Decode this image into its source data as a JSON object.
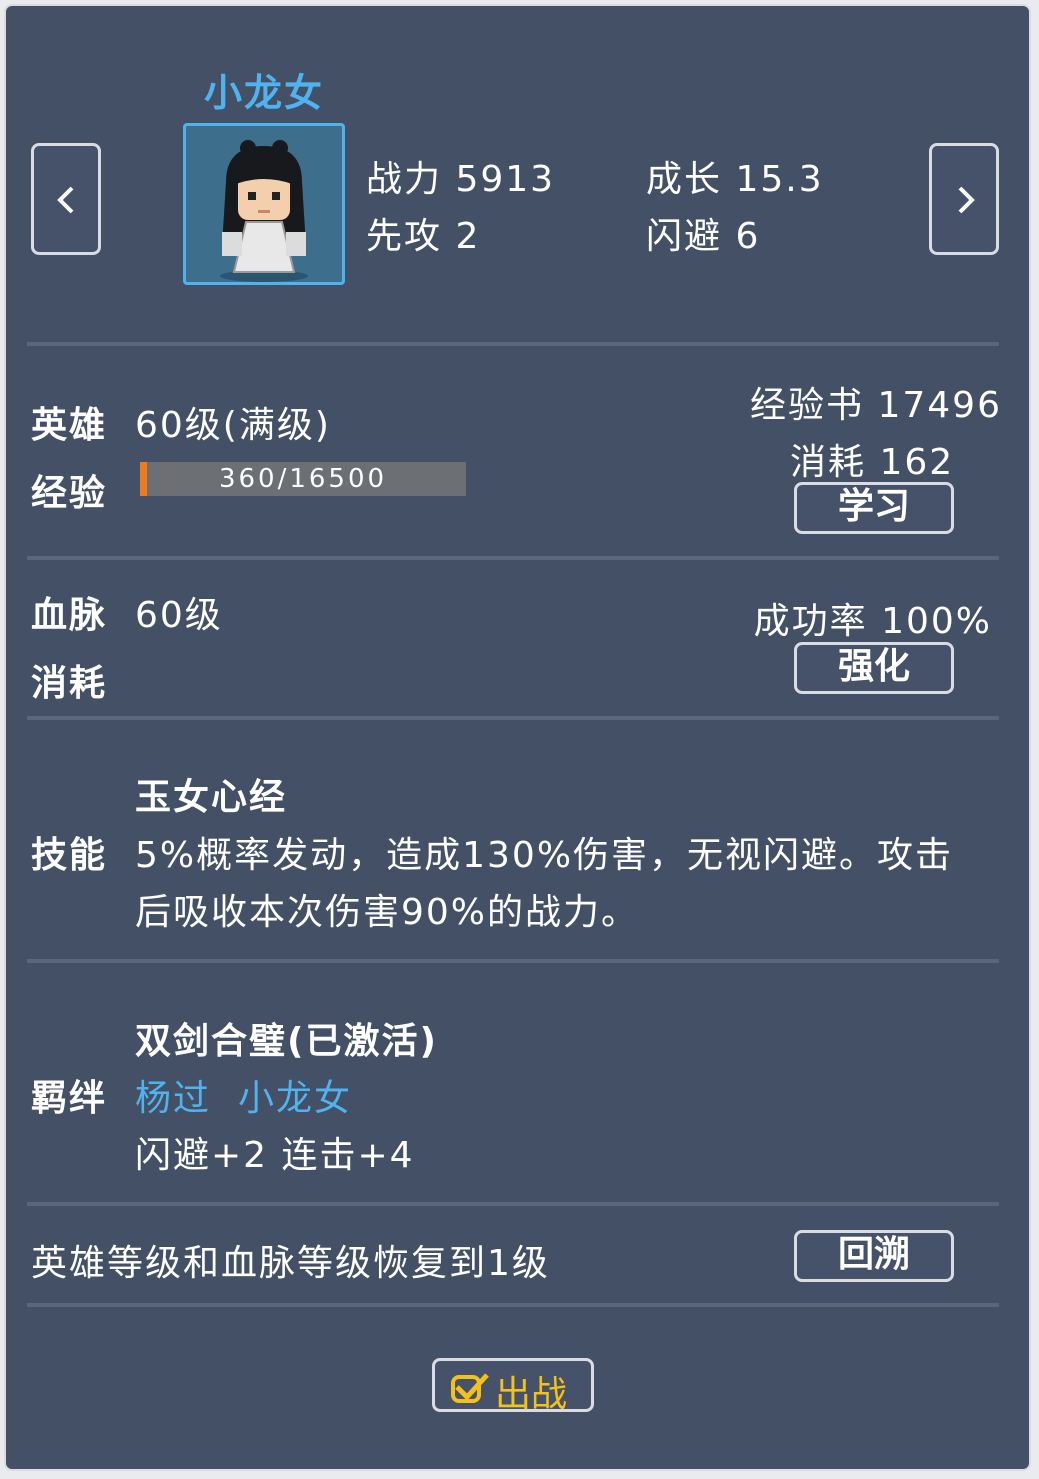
{
  "hero": {
    "name": "小龙女",
    "power_label": "战力",
    "power": "5913",
    "growth_label": "成长",
    "growth": "15.3",
    "initiative_label": "先攻",
    "initiative": "2",
    "dodge_label": "闪避",
    "dodge": "6"
  },
  "level": {
    "label": "英雄",
    "value": "60级(满级)",
    "exp_label": "经验",
    "exp_text": "360/16500",
    "exp_fraction": 0.0218,
    "book_label": "经验书",
    "book_count": "17496",
    "cost_label": "消耗",
    "cost": "162",
    "learn_button": "学习"
  },
  "bloodline": {
    "label": "血脉",
    "value": "60级",
    "cost_label": "消耗",
    "success_label": "成功率",
    "success": "100%",
    "enhance_button": "强化"
  },
  "skill": {
    "label": "技能",
    "name": "玉女心经",
    "desc_line1": "5%概率发动，造成130%伤害，无视闪避。攻击",
    "desc_line2": "后吸收本次伤害90%的战力。"
  },
  "bond": {
    "label": "羁绊",
    "name": "双剑合璧(已激活)",
    "member1": "杨过",
    "member2": "小龙女",
    "effect": "闪避+2 连击+4"
  },
  "reset": {
    "text": "英雄等级和血脉等级恢复到1级",
    "button": "回溯"
  },
  "battle_button": "出战",
  "colors": {
    "panel": "#445066",
    "accent_blue": "#4fb3ef",
    "exp_fill": "#f07a1c",
    "battle_yellow": "#f2c11a"
  },
  "icons": [
    "chevron-left-icon",
    "chevron-right-icon",
    "checkbox-checked-icon"
  ]
}
